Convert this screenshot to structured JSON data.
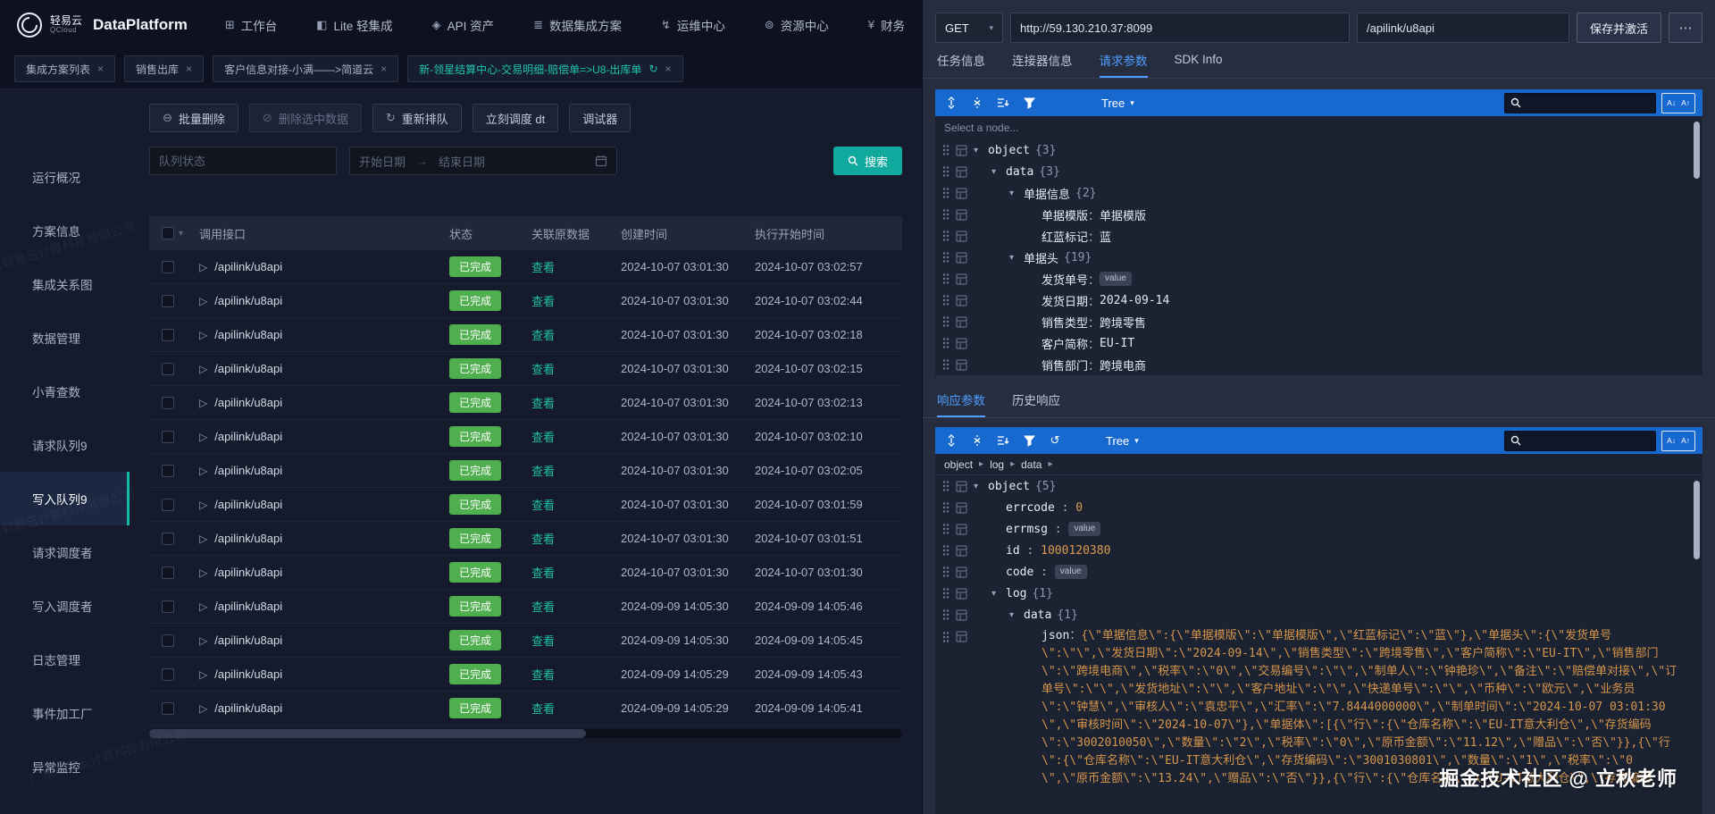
{
  "icons": {
    "close": "×",
    "caret_down": "▾",
    "caret_right": "▸",
    "play": "▷",
    "sync": "↻",
    "batch": "⊖",
    "ban": "⊘",
    "requeue": "↻",
    "arrow_right": "→",
    "undo": "↺",
    "more": "⋯",
    "search_next": "A↓",
    "search_prev": "A↑"
  },
  "navbar": {
    "logo_cn": "轻易云",
    "logo_en": "QCloud",
    "product": "DataPlatform",
    "items": [
      {
        "id": "workbench",
        "label": "工作台",
        "icon": "grid-icon",
        "glyph": "⊞"
      },
      {
        "id": "lite-integration",
        "label": "Lite 轻集成",
        "icon": "lite-icon",
        "glyph": "◧"
      },
      {
        "id": "api-assets",
        "label": "API 资产",
        "icon": "api-icon",
        "glyph": "◈"
      },
      {
        "id": "data-integration",
        "label": "数据集成方案",
        "icon": "integration-icon",
        "glyph": "≣"
      },
      {
        "id": "ops-center",
        "label": "运维中心",
        "icon": "ops-icon",
        "glyph": "↯"
      },
      {
        "id": "resource-center",
        "label": "资源中心",
        "icon": "resource-icon",
        "glyph": "⊚"
      },
      {
        "id": "finance",
        "label": "财务",
        "icon": "finance-icon",
        "glyph": "¥"
      }
    ]
  },
  "tabbar": {
    "tabs": [
      {
        "label": "集成方案列表",
        "active": false
      },
      {
        "label": "销售出库",
        "active": false
      },
      {
        "label": "客户信息对接-小满——>简道云",
        "active": false
      },
      {
        "label": "新-领星结算中心-交易明细-赔偿单=>U8-出库单",
        "active": true
      }
    ]
  },
  "sidebar": {
    "items": [
      {
        "label": "运行概况"
      },
      {
        "label": "方案信息"
      },
      {
        "label": "集成关系图"
      },
      {
        "label": "数据管理"
      },
      {
        "label": "小青查数"
      },
      {
        "label": "请求队列9"
      },
      {
        "label": "写入队列9",
        "active": true
      },
      {
        "label": "请求调度者"
      },
      {
        "label": "写入调度者"
      },
      {
        "label": "日志管理"
      },
      {
        "label": "事件加工厂"
      },
      {
        "label": "异常监控"
      }
    ]
  },
  "actions": {
    "batch_delete": "批量删除",
    "delete_selected": "删除选中数据",
    "requeue": "重新排队",
    "schedule_now": "立刻调度 dt",
    "debugger": "调试器"
  },
  "filters": {
    "queue_status": "队列状态",
    "start_date": "开始日期",
    "end_date": "结束日期",
    "search": "搜索"
  },
  "table": {
    "columns": [
      "调用接口",
      "状态",
      "关联原数据",
      "创建时间",
      "执行开始时间"
    ],
    "rows": [
      {
        "api": "/apilink/u8api",
        "status": "已完成",
        "link": "查看",
        "created": "2024-10-07 03:01:30",
        "started": "2024-10-07 03:02:57"
      },
      {
        "api": "/apilink/u8api",
        "status": "已完成",
        "link": "查看",
        "created": "2024-10-07 03:01:30",
        "started": "2024-10-07 03:02:44"
      },
      {
        "api": "/apilink/u8api",
        "status": "已完成",
        "link": "查看",
        "created": "2024-10-07 03:01:30",
        "started": "2024-10-07 03:02:18"
      },
      {
        "api": "/apilink/u8api",
        "status": "已完成",
        "link": "查看",
        "created": "2024-10-07 03:01:30",
        "started": "2024-10-07 03:02:15"
      },
      {
        "api": "/apilink/u8api",
        "status": "已完成",
        "link": "查看",
        "created": "2024-10-07 03:01:30",
        "started": "2024-10-07 03:02:13"
      },
      {
        "api": "/apilink/u8api",
        "status": "已完成",
        "link": "查看",
        "created": "2024-10-07 03:01:30",
        "started": "2024-10-07 03:02:10"
      },
      {
        "api": "/apilink/u8api",
        "status": "已完成",
        "link": "查看",
        "created": "2024-10-07 03:01:30",
        "started": "2024-10-07 03:02:05"
      },
      {
        "api": "/apilink/u8api",
        "status": "已完成",
        "link": "查看",
        "created": "2024-10-07 03:01:30",
        "started": "2024-10-07 03:01:59"
      },
      {
        "api": "/apilink/u8api",
        "status": "已完成",
        "link": "查看",
        "created": "2024-10-07 03:01:30",
        "started": "2024-10-07 03:01:51"
      },
      {
        "api": "/apilink/u8api",
        "status": "已完成",
        "link": "查看",
        "created": "2024-10-07 03:01:30",
        "started": "2024-10-07 03:01:30"
      },
      {
        "api": "/apilink/u8api",
        "status": "已完成",
        "link": "查看",
        "created": "2024-09-09 14:05:30",
        "started": "2024-09-09 14:05:46"
      },
      {
        "api": "/apilink/u8api",
        "status": "已完成",
        "link": "查看",
        "created": "2024-09-09 14:05:30",
        "started": "2024-09-09 14:05:45"
      },
      {
        "api": "/apilink/u8api",
        "status": "已完成",
        "link": "查看",
        "created": "2024-09-09 14:05:29",
        "started": "2024-09-09 14:05:43"
      },
      {
        "api": "/apilink/u8api",
        "status": "已完成",
        "link": "查看",
        "created": "2024-09-09 14:05:29",
        "started": "2024-09-09 14:05:41"
      }
    ]
  },
  "request_panel": {
    "method": "GET",
    "url": "http://59.130.210.37:8099",
    "path": "/apilink/u8api",
    "save_label": "保存并激活",
    "tabs": [
      "任务信息",
      "连接器信息",
      "请求参数",
      "SDK Info"
    ],
    "active_tab": "请求参数",
    "tree_mode": "Tree",
    "hint": "Select a node...",
    "tree": [
      {
        "indent": 0,
        "expand": true,
        "key": "object",
        "count": "{3}"
      },
      {
        "indent": 1,
        "expand": true,
        "key": "data",
        "count": "{3}"
      },
      {
        "indent": 2,
        "expand": true,
        "key": "单据信息",
        "count": "{2}"
      },
      {
        "indent": 3,
        "key": "单据模版",
        "sep": "：",
        "value": "单据模版",
        "vtype": "str"
      },
      {
        "indent": 3,
        "key": "红蓝标记",
        "sep": "：",
        "value": "蓝",
        "vtype": "str"
      },
      {
        "indent": 2,
        "expand": true,
        "key": "单据头",
        "count": "{19}"
      },
      {
        "indent": 3,
        "key": "发货单号",
        "sep": "：",
        "badge": "value"
      },
      {
        "indent": 3,
        "key": "发货日期",
        "sep": "：",
        "value": "2024-09-14",
        "vtype": "str"
      },
      {
        "indent": 3,
        "key": "销售类型",
        "sep": "：",
        "value": "跨境零售",
        "vtype": "str"
      },
      {
        "indent": 3,
        "key": "客户简称",
        "sep": "：",
        "value": "EU-IT",
        "vtype": "str"
      },
      {
        "indent": 3,
        "key": "销售部门",
        "sep": "：",
        "value": "跨境电商",
        "vtype": "str"
      }
    ]
  },
  "response_panel": {
    "tabs": [
      "响应参数",
      "历史响应"
    ],
    "active_tab": "响应参数",
    "tree_mode": "Tree",
    "breadcrumb": [
      "object",
      "log",
      "data"
    ],
    "tree": [
      {
        "indent": 0,
        "expand": true,
        "key": "object",
        "count": "{5}"
      },
      {
        "indent": 1,
        "key": "errcode",
        "sep": " : ",
        "value": "0",
        "vtype": "num"
      },
      {
        "indent": 1,
        "key": "errmsg",
        "sep": " : ",
        "badge": "value"
      },
      {
        "indent": 1,
        "key": "id",
        "sep": " : ",
        "value": "1000120380",
        "vtype": "num"
      },
      {
        "indent": 1,
        "key": "code",
        "sep": " : ",
        "badge": "value"
      },
      {
        "indent": 1,
        "expand": true,
        "key": "log",
        "count": "{1}"
      },
      {
        "indent": 2,
        "expand": true,
        "key": "data",
        "count": "{1}"
      },
      {
        "indent": 3,
        "key": "json",
        "sep": "：",
        "wrap": true,
        "vtype": "json",
        "value": "{\\\"单据信息\\\":{\\\"单据模版\\\":\\\"单据模版\\\",\\\"红蓝标记\\\":\\\"蓝\\\"},\\\"单据头\\\":{\\\"发货单号\\\":\\\"\\\",\\\"发货日期\\\":\\\"2024-09-14\\\",\\\"销售类型\\\":\\\"跨境零售\\\",\\\"客户简称\\\":\\\"EU-IT\\\",\\\"销售部门\\\":\\\"跨境电商\\\",\\\"税率\\\":\\\"0\\\",\\\"交易编号\\\":\\\"\\\",\\\"制单人\\\":\\\"钟艳珍\\\",\\\"备注\\\":\\\"赔偿单对接\\\",\\\"订单号\\\":\\\"\\\",\\\"发货地址\\\":\\\"\\\",\\\"客户地址\\\":\\\"\\\",\\\"快递单号\\\":\\\"\\\",\\\"币种\\\":\\\"欧元\\\",\\\"业务员\\\":\\\"钟慧\\\",\\\"审核人\\\":\\\"袁忠平\\\",\\\"汇率\\\":\\\"7.8444000000\\\",\\\"制单时间\\\":\\\"2024-10-07 03:01:30\\\",\\\"审核时间\\\":\\\"2024-10-07\\\"},\\\"单据体\\\":[{\\\"行\\\":{\\\"仓库名称\\\":\\\"EU-IT意大利仓\\\",\\\"存货编码\\\":\\\"3002010050\\\",\\\"数量\\\":\\\"2\\\",\\\"税率\\\":\\\"0\\\",\\\"原币金额\\\":\\\"11.12\\\",\\\"赠品\\\":\\\"否\\\"}},{\\\"行\\\":{\\\"仓库名称\\\":\\\"EU-IT意大利仓\\\",\\\"存货编码\\\":\\\"3001030801\\\",\\\"数量\\\":\\\"1\\\",\\\"税率\\\":\\\"0\\\",\\\"原币金额\\\":\\\"13.24\\\",\\\"赠品\\\":\\\"否\\\"}},{\\\"行\\\":{\\\"仓库名称\\\":\\\"EU-IT意大利仓\\\",\\\"存货编码"
      }
    ]
  },
  "watermarks": {
    "community": "掘金技术社区 @ 立秋老师",
    "company": "广东轻易云计算科技有限公司"
  }
}
